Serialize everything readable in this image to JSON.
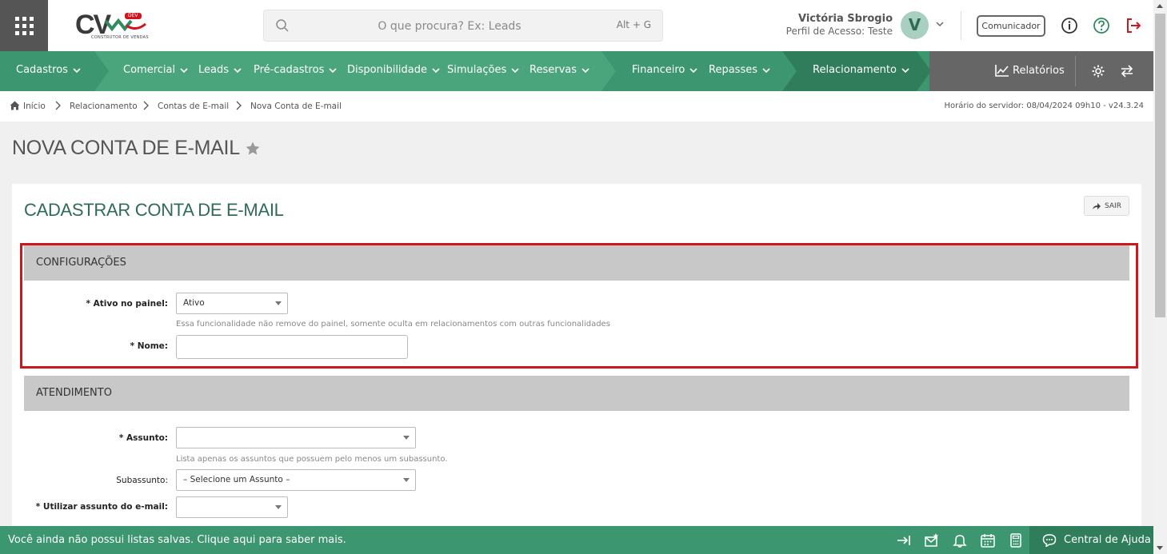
{
  "header": {
    "logo_text": "CV",
    "logo_badge": "DEV",
    "logo_subtitle": "CONSTRUTOR DE VENDAS",
    "search_placeholder": "O que procura? Ex: Leads",
    "search_shortcut": "Alt + G",
    "user_name": "Victória Sbrogio",
    "user_role": "Perfil de Acesso: Teste",
    "avatar_letter": "V",
    "comunicador_label": "Comunicador"
  },
  "nav": {
    "items": [
      {
        "label": "Cadastros"
      },
      {
        "label": "Comercial"
      },
      {
        "label": "Leads"
      },
      {
        "label": "Pré-cadastros"
      },
      {
        "label": "Disponibilidade"
      },
      {
        "label": "Simulações"
      },
      {
        "label": "Reservas"
      },
      {
        "label": "Financeiro"
      },
      {
        "label": "Repasses"
      },
      {
        "label": "Relacionamento"
      }
    ],
    "reports_label": "Relatórios",
    "colors": {
      "primary": "#3c9670",
      "segment_light": "#4aa47c",
      "segment_dark": "#2f7d5b",
      "right": "#666666"
    }
  },
  "breadcrumb": {
    "items": [
      "Início",
      "Relacionamento",
      "Contas de E-mail",
      "Nova Conta de E-mail"
    ],
    "server_time": "Horário do servidor: 08/04/2024 09h10 - v24.3.24"
  },
  "page": {
    "title": "NOVA CONTA DE E-MAIL",
    "form_title": "CADASTRAR CONTA DE E-MAIL",
    "exit_label": "SAIR"
  },
  "sections": {
    "config": {
      "title": "CONFIGURAÇÕES",
      "ativo_label": "* Ativo no painel:",
      "ativo_value": "Ativo",
      "ativo_help": "Essa funcionalidade não remove do painel, somente oculta em relacionamentos com outras funcionalidades",
      "nome_label": "* Nome:",
      "nome_value": ""
    },
    "atendimento": {
      "title": "ATENDIMENTO",
      "assunto_label": "* Assunto:",
      "assunto_value": "",
      "assunto_help": "Lista apenas os assuntos que possuem pelo menos um subassunto.",
      "subassunto_label": "Subassunto:",
      "subassunto_value": "– Selecione um Assunto –",
      "utilizar_label": "* Utilizar assunto do e-mail:",
      "utilizar_value": ""
    }
  },
  "footer": {
    "message": "Você ainda não possui listas salvas. Clique aqui para saber mais.",
    "help_center_label": "Central de Ajuda"
  },
  "highlight_color": "#d0161d"
}
